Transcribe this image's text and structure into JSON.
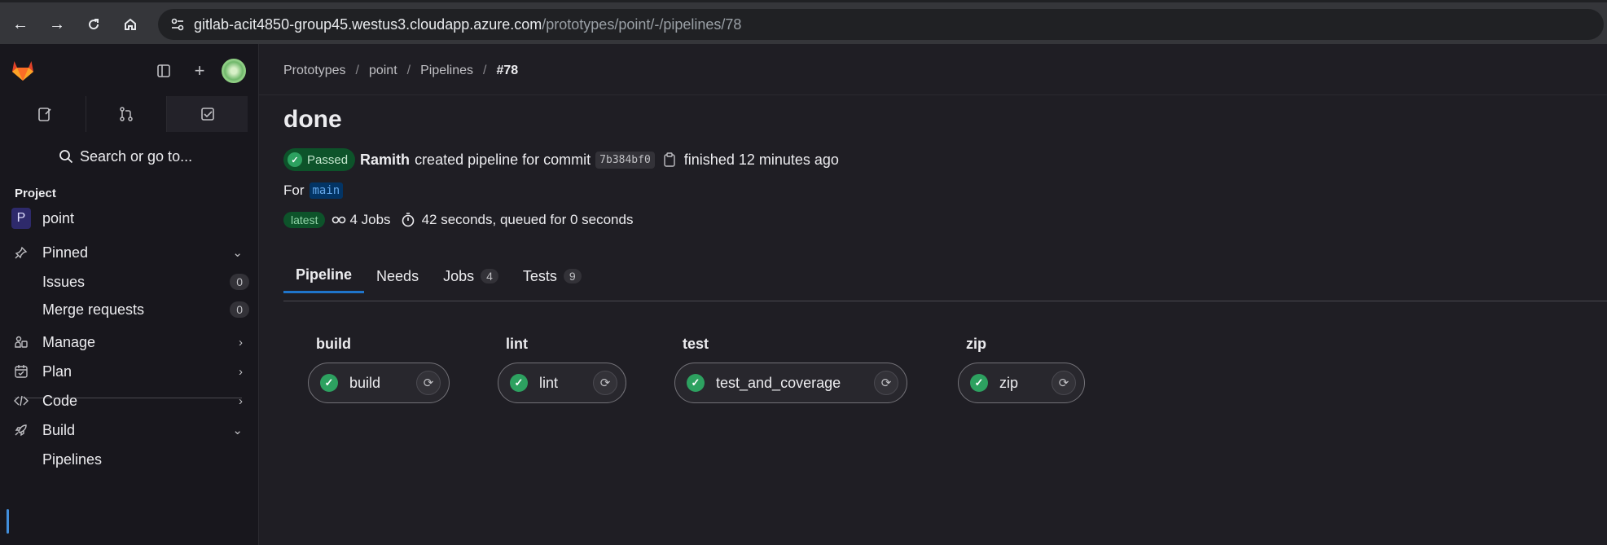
{
  "browser": {
    "url_host": "gitlab-acit4850-group45.westus3.cloudapp.azure.com",
    "url_path": "/prototypes/point/-/pipelines/78"
  },
  "sidebar": {
    "search_label": "Search or go to...",
    "section_label": "Project",
    "project": {
      "initial": "P",
      "name": "point"
    },
    "items": [
      {
        "label": "Pinned",
        "icon": "pin-icon",
        "chevron": "down"
      },
      {
        "label": "Issues",
        "count": "0"
      },
      {
        "label": "Merge requests",
        "count": "0"
      },
      {
        "label": "Manage",
        "icon": "manage-icon",
        "chevron": "right"
      },
      {
        "label": "Plan",
        "icon": "plan-icon",
        "chevron": "right"
      },
      {
        "label": "Code",
        "icon": "code-icon",
        "chevron": "right"
      },
      {
        "label": "Build",
        "icon": "rocket-icon",
        "chevron": "down"
      },
      {
        "label": "Pipelines"
      }
    ]
  },
  "breadcrumb": [
    "Prototypes",
    "point",
    "Pipelines",
    "#78"
  ],
  "pipeline": {
    "title": "done",
    "status": "Passed",
    "author": "Ramith",
    "created_text": "created pipeline for commit",
    "commit_sha": "7b384bf0",
    "finished_text": "finished 12 minutes ago",
    "for_label": "For",
    "branch": "main",
    "latest_label": "latest",
    "jobs_text": "4 Jobs",
    "duration_text": "42 seconds, queued for 0 seconds"
  },
  "tabs": [
    {
      "label": "Pipeline",
      "active": true
    },
    {
      "label": "Needs"
    },
    {
      "label": "Jobs",
      "count": "4"
    },
    {
      "label": "Tests",
      "count": "9"
    }
  ],
  "stages": [
    {
      "title": "build",
      "job": "build"
    },
    {
      "title": "lint",
      "job": "lint"
    },
    {
      "title": "test",
      "job": "test_and_coverage"
    },
    {
      "title": "zip",
      "job": "zip"
    }
  ],
  "colors": {
    "accent": "#1f75cb",
    "success": "#2da160",
    "background": "#1f1e24",
    "sidebar": "#18171d"
  }
}
